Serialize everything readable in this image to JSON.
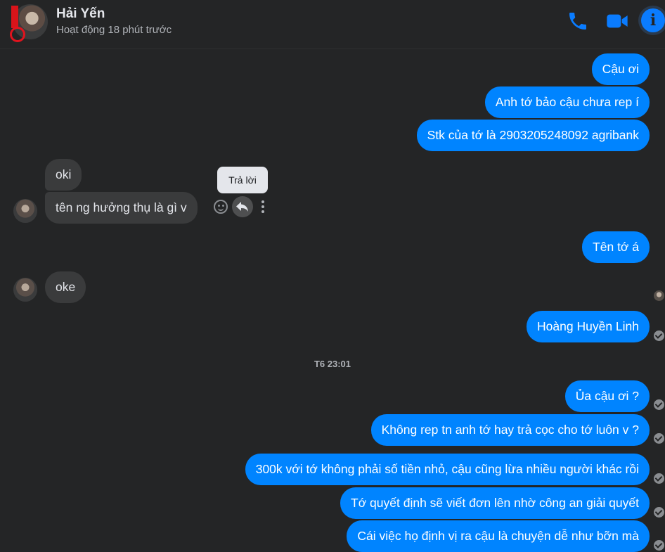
{
  "header": {
    "name": "Hải Yến",
    "status": "Hoạt động 18 phút trước"
  },
  "icons": {
    "phone": "phone-icon",
    "video": "video-camera-icon",
    "info": "info-icon",
    "emoji": "smiley-icon",
    "reply": "reply-arrow-icon",
    "more": "more-vertical-icon",
    "seen": "check-circle-icon"
  },
  "colors": {
    "accent": "#0084ff",
    "background": "#242526",
    "incoming_bubble": "#3a3b3c"
  },
  "messages": {
    "m1": "Cậu ơi",
    "m2": "Anh tớ bảo cậu chưa rep í",
    "m3": "Stk của tớ là 2903205248092 agribank",
    "m4": "oki",
    "m5": "tên ng hưởng thụ là gì v",
    "m6": "Tên tớ á",
    "m7": "oke",
    "m8": "Hoàng Huyền Linh",
    "m9": "Ủa cậu ơi ?",
    "m10": "Không rep tn anh tớ hay trả cọc cho tớ luôn v ?",
    "m11": "300k với tớ không phải số tiền nhỏ, cậu cũng lừa nhiều người khác rồi",
    "m12": "Tớ quyết định sẽ viết đơn lên nhờ công an giải quyết",
    "m13": "Cái việc họ định vị ra cậu là chuyện dễ như bỡn mà"
  },
  "timestamp": "T6 23:01",
  "tooltip": "Trả lời"
}
